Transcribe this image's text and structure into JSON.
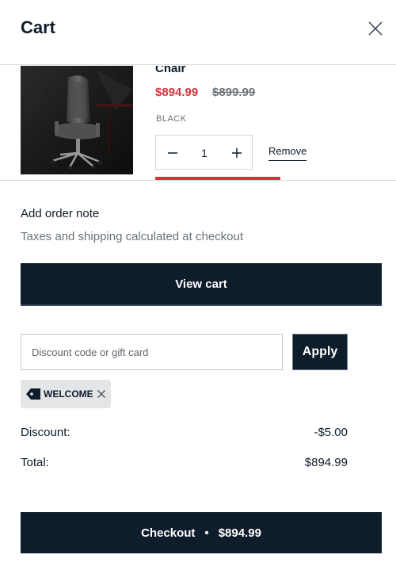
{
  "header": {
    "title": "Cart",
    "close_icon": "close-icon"
  },
  "item": {
    "name": "Chair",
    "sale_price": "$894.99",
    "original_price": "$899.99",
    "variant": "BLACK",
    "quantity": "1",
    "remove_label": "Remove",
    "image_icon": "office-chair-image",
    "colors": {
      "sale": "#d6323a",
      "strike": "#6b7278"
    }
  },
  "notes": {
    "order_note": "Add order note",
    "tax_note": "Taxes and shipping calculated at checkout"
  },
  "view_cart_label": "View cart",
  "discount": {
    "placeholder": "Discount code or gift card",
    "value": "",
    "apply_label": "Apply",
    "applied_code": "WELCOME",
    "tag_icon": "tag-icon",
    "remove_icon": "close-icon"
  },
  "summary": {
    "discount_label": "Discount:",
    "discount_value": "-$5.00",
    "total_label": "Total:",
    "total_value": "$894.99"
  },
  "checkout": {
    "label": "Checkout",
    "separator": "•",
    "amount": "$894.99"
  },
  "theme": {
    "primary": "#0e1c2b",
    "accent_red": "#d6323a",
    "muted_text": "#6b7278",
    "tag_bg": "#e4e5e7"
  }
}
